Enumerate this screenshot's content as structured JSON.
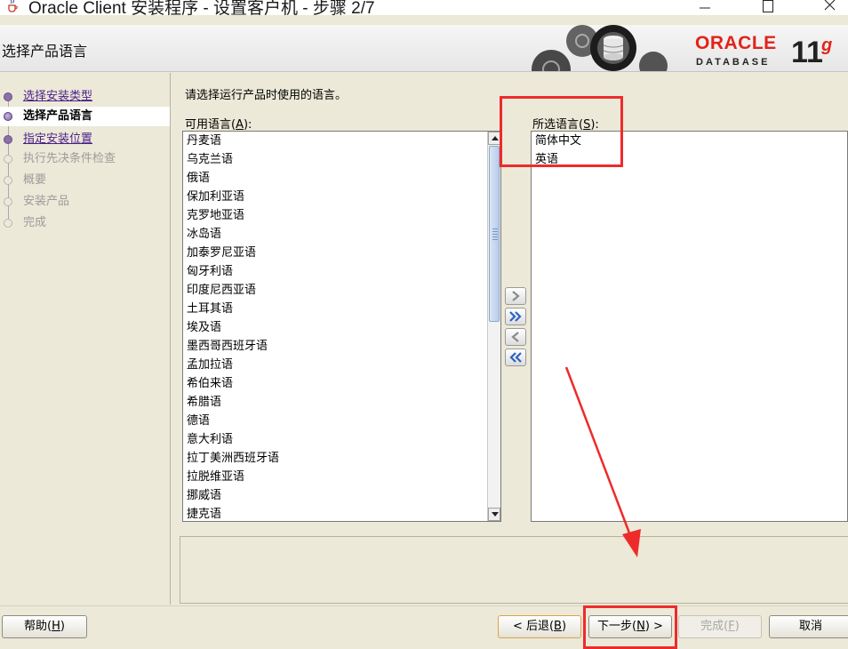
{
  "window": {
    "title": "Oracle Client 安装程序 - 设置客户机 - 步骤 2/7",
    "icons": {
      "app": "java-cup-icon",
      "minimize": "minimize-icon",
      "maximize": "maximize-icon",
      "close": "close-icon"
    }
  },
  "header": {
    "page_title": "选择产品语言",
    "logo": {
      "brand": "ORACLE",
      "product": "DATABASE",
      "version": "11",
      "version_suffix": "g"
    },
    "colors": {
      "brand_red": "#e2231a"
    }
  },
  "steps": [
    {
      "label": "选择安装类型",
      "state": "done"
    },
    {
      "label": "选择产品语言",
      "state": "current"
    },
    {
      "label": "指定安装位置",
      "state": "done"
    },
    {
      "label": "执行先决条件检查",
      "state": "pending"
    },
    {
      "label": "概要",
      "state": "pending"
    },
    {
      "label": "安装产品",
      "state": "pending"
    },
    {
      "label": "完成",
      "state": "pending"
    }
  ],
  "main": {
    "instruction": "请选择运行产品时使用的语言。",
    "available": {
      "label_prefix": "可用语言(",
      "label_mnemonic": "A",
      "label_suffix": "):",
      "items": [
        "丹麦语",
        "乌克兰语",
        "俄语",
        "保加利亚语",
        "克罗地亚语",
        "冰岛语",
        "加泰罗尼亚语",
        "匈牙利语",
        "印度尼西亚语",
        "土耳其语",
        "埃及语",
        "墨西哥西班牙语",
        "孟加拉语",
        "希伯来语",
        "希腊语",
        "德语",
        "意大利语",
        "拉丁美洲西班牙语",
        "拉脱维亚语",
        "挪威语",
        "捷克语"
      ]
    },
    "selected": {
      "label_prefix": "所选语言(",
      "label_mnemonic": "S",
      "label_suffix": "):",
      "items": [
        "简体中文",
        "英语"
      ]
    },
    "move_buttons": [
      "move-right-icon",
      "move-all-right-icon",
      "move-left-icon",
      "move-all-left-icon"
    ]
  },
  "buttons": {
    "help": {
      "prefix": "帮助(",
      "mnemonic": "H",
      "suffix": ")"
    },
    "back": {
      "prefix": "< 后退(",
      "mnemonic": "B",
      "suffix": ")"
    },
    "next": {
      "prefix": "下一步(",
      "mnemonic": "N",
      "suffix": ") >"
    },
    "finish": {
      "prefix": "完成(",
      "mnemonic": "F",
      "suffix": ")"
    },
    "cancel": {
      "label": "取消"
    }
  },
  "annotation": {
    "color": "#ee2b2b"
  }
}
